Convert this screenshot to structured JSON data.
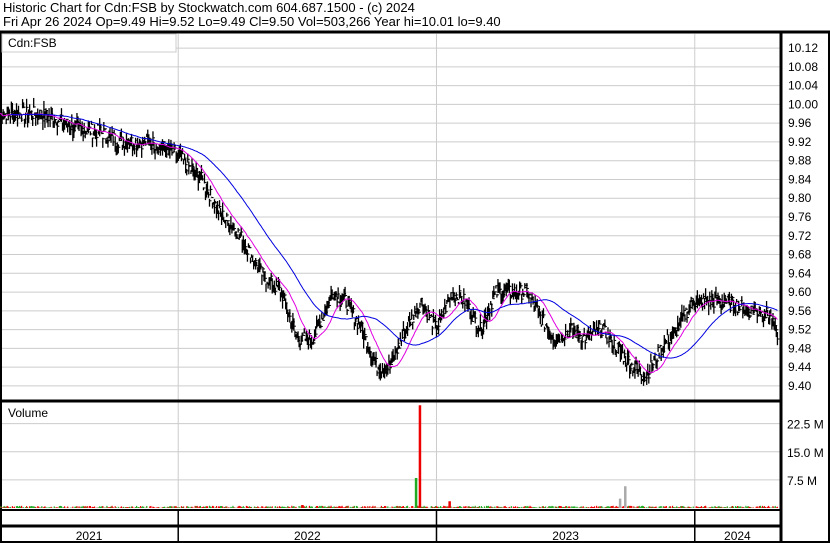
{
  "header": {
    "title": "Historic Chart for Cdn:FSB by Stockwatch.com 604.687.1500 - (c) 2024",
    "quote": "Fri Apr 26 2024  Op=9.49  Hi=9.52  Lo=9.49  Cl=9.50  Vol=503,266  Year hi=10.01  lo=9.40"
  },
  "chart_data": {
    "type": "line",
    "title": "Cdn:FSB",
    "price_ticks": [
      "10.12",
      "10.08",
      "10.04",
      "10.00",
      "9.96",
      "9.92",
      "9.88",
      "9.84",
      "9.80",
      "9.76",
      "9.72",
      "9.68",
      "9.64",
      "9.60",
      "9.56",
      "9.52",
      "9.48",
      "9.44",
      "9.40"
    ],
    "ylim": [
      9.37,
      10.15
    ],
    "xlim": [
      2021.31,
      2024.33
    ],
    "year_labels": [
      "2021",
      "2022",
      "2023",
      "2024"
    ],
    "year_boundaries": [
      2022,
      2023,
      2024
    ],
    "volume_label": "Volume",
    "volume_ticks": [
      "22.5 M",
      "15.0 M",
      "7.5 M"
    ],
    "volume_ylim": [
      0,
      28
    ],
    "close": [
      [
        2021.31,
        9.98
      ],
      [
        2021.37,
        9.98
      ],
      [
        2021.46,
        9.98
      ],
      [
        2021.52,
        9.97
      ],
      [
        2021.6,
        9.95
      ],
      [
        2021.7,
        9.94
      ],
      [
        2021.78,
        9.92
      ],
      [
        2021.89,
        9.92
      ],
      [
        2021.98,
        9.9
      ],
      [
        2022.09,
        9.84
      ],
      [
        2022.16,
        9.77
      ],
      [
        2022.24,
        9.72
      ],
      [
        2022.32,
        9.64
      ],
      [
        2022.4,
        9.6
      ],
      [
        2022.46,
        9.5
      ],
      [
        2022.52,
        9.5
      ],
      [
        2022.6,
        9.6
      ],
      [
        2022.65,
        9.58
      ],
      [
        2022.71,
        9.52
      ],
      [
        2022.77,
        9.44
      ],
      [
        2022.82,
        9.44
      ],
      [
        2022.88,
        9.52
      ],
      [
        2022.94,
        9.58
      ],
      [
        2023.0,
        9.52
      ],
      [
        2023.06,
        9.6
      ],
      [
        2023.11,
        9.58
      ],
      [
        2023.17,
        9.52
      ],
      [
        2023.23,
        9.6
      ],
      [
        2023.29,
        9.6
      ],
      [
        2023.35,
        9.6
      ],
      [
        2023.41,
        9.54
      ],
      [
        2023.46,
        9.5
      ],
      [
        2023.52,
        9.52
      ],
      [
        2023.58,
        9.5
      ],
      [
        2023.64,
        9.52
      ],
      [
        2023.7,
        9.48
      ],
      [
        2023.76,
        9.44
      ],
      [
        2023.81,
        9.42
      ],
      [
        2023.87,
        9.48
      ],
      [
        2023.93,
        9.52
      ],
      [
        2023.99,
        9.58
      ],
      [
        2024.05,
        9.58
      ],
      [
        2024.11,
        9.58
      ],
      [
        2024.17,
        9.57
      ],
      [
        2024.23,
        9.56
      ],
      [
        2024.29,
        9.55
      ],
      [
        2024.32,
        9.5
      ]
    ],
    "volume_spikes_M": [
      [
        2022.92,
        8.0,
        "up"
      ],
      [
        2022.935,
        27.4,
        "down"
      ],
      [
        2022.48,
        0.8,
        "down"
      ],
      [
        2023.05,
        1.8,
        "down"
      ],
      [
        2023.73,
        5.8,
        "flat"
      ],
      [
        2023.71,
        2.5,
        "flat"
      ]
    ],
    "series": [
      {
        "name": "short MA",
        "color": "#e000e0"
      },
      {
        "name": "long MA",
        "color": "#0000e0"
      }
    ]
  }
}
